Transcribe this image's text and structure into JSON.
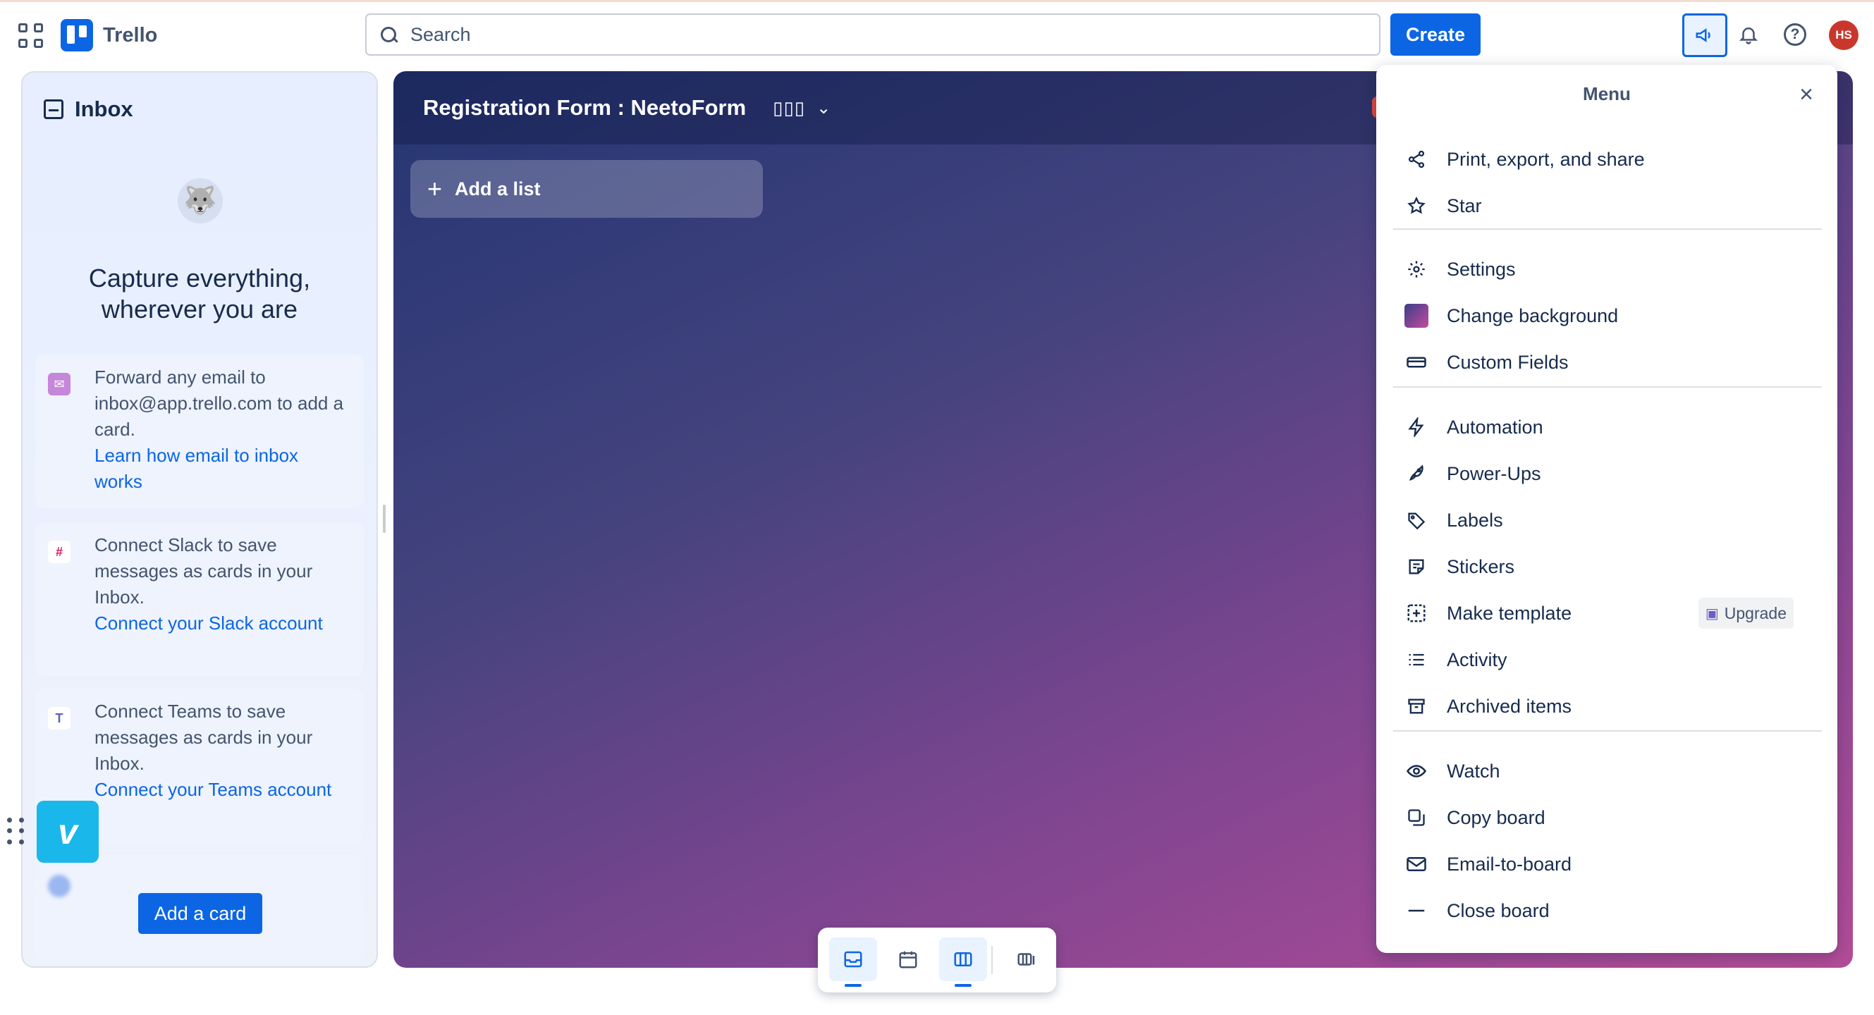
{
  "header": {
    "app_name": "Trello",
    "search_placeholder": "Search",
    "create_label": "Create",
    "avatar_initials": "HS"
  },
  "inbox": {
    "title": "Inbox",
    "headline_line1": "Capture everything,",
    "headline_line2": "wherever you are",
    "tips": [
      {
        "icon": "email-icon",
        "text": "Forward any email to inbox@app.trello.com to add a card.",
        "link": "Learn how email to inbox works"
      },
      {
        "icon": "slack-icon",
        "text": "Connect Slack to save messages as cards in your Inbox.",
        "link": "Connect your Slack account"
      },
      {
        "icon": "teams-icon",
        "text": "Connect Teams to save messages as cards in your Inbox.",
        "link": "Connect your Teams account"
      }
    ],
    "add_card_label": "Add a card"
  },
  "board": {
    "title": "Registration Form : NeetoForm",
    "add_list_label": "Add a list"
  },
  "menu": {
    "title": "Menu",
    "sections": [
      [
        {
          "icon": "share-icon",
          "label": "Print, export, and share"
        },
        {
          "icon": "star-icon",
          "label": "Star"
        }
      ],
      [
        {
          "icon": "gear-icon",
          "label": "Settings"
        },
        {
          "icon": "background-swatch",
          "label": "Change background"
        },
        {
          "icon": "custom-fields-icon",
          "label": "Custom Fields"
        }
      ],
      [
        {
          "icon": "lightning-icon",
          "label": "Automation"
        },
        {
          "icon": "rocket-icon",
          "label": "Power-Ups"
        },
        {
          "icon": "tag-icon",
          "label": "Labels"
        },
        {
          "icon": "sticker-icon",
          "label": "Stickers"
        },
        {
          "icon": "template-icon",
          "label": "Make template",
          "badge": "Upgrade"
        },
        {
          "icon": "list-icon",
          "label": "Activity"
        },
        {
          "icon": "archive-icon",
          "label": "Archived items"
        }
      ],
      [
        {
          "icon": "eye-icon",
          "label": "Watch"
        },
        {
          "icon": "copy-icon",
          "label": "Copy board"
        },
        {
          "icon": "mail-icon",
          "label": "Email-to-board"
        },
        {
          "icon": "minus-icon",
          "label": "Close board"
        }
      ]
    ]
  },
  "switcher": {
    "items": [
      {
        "name": "inbox-view",
        "active": true
      },
      {
        "name": "planner-view",
        "active": false
      },
      {
        "name": "board-view",
        "active": true
      },
      {
        "name": "switch-boards",
        "active": false
      }
    ]
  },
  "colors": {
    "primary": "#0c66e4",
    "avatar": "#c9372c",
    "vimeo": "#1ab7ea"
  }
}
